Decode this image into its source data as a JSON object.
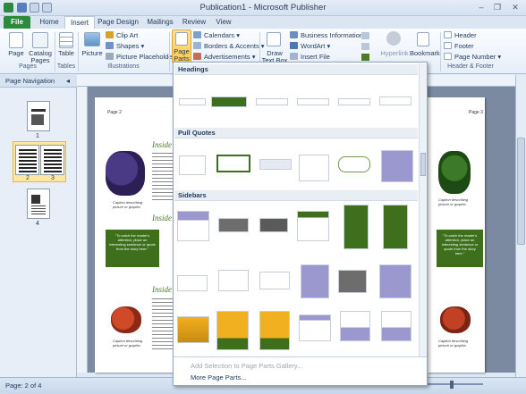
{
  "window": {
    "title": "Publication1 - Microsoft Publisher",
    "controls": [
      "–",
      "❐",
      "✕"
    ]
  },
  "tabs": [
    "File",
    "Home",
    "Insert",
    "Page Design",
    "Mailings",
    "Review",
    "View"
  ],
  "ribbon": {
    "pages": {
      "page": "Page",
      "catalog_pages": "Catalog Pages",
      "group": "Pages"
    },
    "tables": {
      "table": "Table",
      "group": "Tables"
    },
    "illustrations": {
      "picture": "Picture",
      "clip_art": "Clip Art",
      "shapes": "Shapes",
      "placeholder": "Picture Placeholder",
      "group": "Illustrations"
    },
    "building_blocks": {
      "page_parts": "Page Parts",
      "calendars": "Calendars",
      "borders": "Borders & Accents",
      "advertisements": "Advertisements"
    },
    "text": {
      "draw_text_box": "Draw Text Box",
      "business_info": "Business Information",
      "wordart": "WordArt",
      "insert_file": "Insert File"
    },
    "links": {
      "hyperlink": "Hyperlink",
      "bookmark": "Bookmark"
    },
    "header_footer": {
      "header": "Header",
      "footer": "Footer",
      "page_number": "Page Number",
      "group": "Header & Footer"
    }
  },
  "navigation": {
    "title": "Page Navigation",
    "pages": [
      "1",
      "2",
      "3",
      "4"
    ]
  },
  "gallery": {
    "sections": {
      "headings": "Headings",
      "pull_quotes": "Pull Quotes",
      "sidebars": "Sidebars"
    },
    "add_selection": "Add Selection to Page Parts Gallery...",
    "more": "More Page Parts..."
  },
  "status": {
    "page": "Page: 2 of 4"
  },
  "document": {
    "header_left": "Page 2",
    "header_right": "Page 3",
    "inside_heading": "Inside",
    "pull_quote": "\"To catch the reader's attention, place an interesting sentence or quote from the story here.\"",
    "caption": "Caption describing picture or graphic."
  },
  "colors": {
    "file_tab": "#2a8b3c",
    "accent_green": "#3e6f1c",
    "heading_green": "#4f7a25",
    "sidebar_purple": "#9b97cf",
    "workspace": "#7b8aa0"
  }
}
